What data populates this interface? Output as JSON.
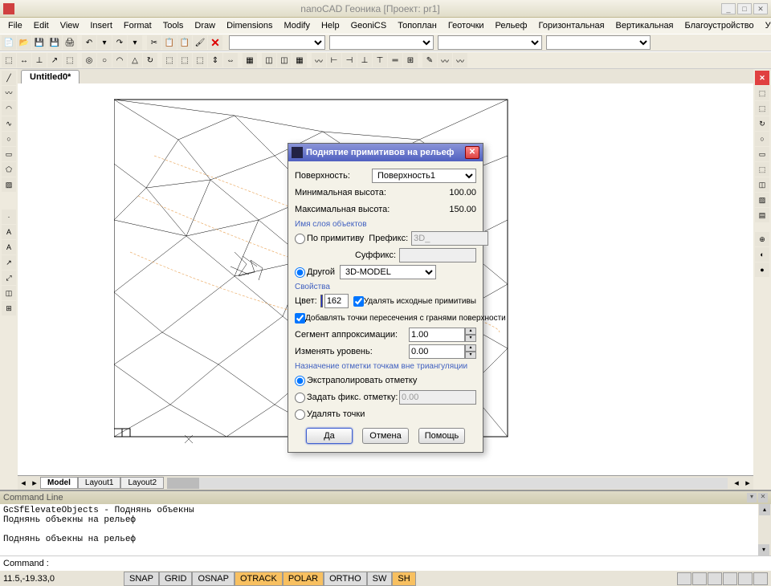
{
  "app": {
    "title": "nanoCAD Геоника [Проект: pr1]"
  },
  "menu": [
    "File",
    "Edit",
    "View",
    "Insert",
    "Format",
    "Tools",
    "Draw",
    "Dimensions",
    "Modify",
    "Help",
    "GeoniCS",
    "Топоплан",
    "Геоточки",
    "Рельеф",
    "Горизонтальная",
    "Вертикальная",
    "Благоустройство",
    "Утилиты"
  ],
  "doc_tab": "Untitled0*",
  "layout_tabs": {
    "active": "Model",
    "tabs": [
      "Model",
      "Layout1",
      "Layout2"
    ]
  },
  "cmd": {
    "title": "Command Line",
    "text": "GcSfElevateObjects - Поднянь объекны\nПоднянь объекны на рельеф\n\nПоднянь объекны на рельеф",
    "prompt": "Command :"
  },
  "status": {
    "coords": "11.5,-19.33,0",
    "toggles": [
      {
        "label": "SNAP",
        "on": false
      },
      {
        "label": "GRID",
        "on": false
      },
      {
        "label": "OSNAP",
        "on": false
      },
      {
        "label": "OTRACK",
        "on": true
      },
      {
        "label": "POLAR",
        "on": true
      },
      {
        "label": "ORTHO",
        "on": false
      },
      {
        "label": "SW",
        "on": false
      },
      {
        "label": "SH",
        "on": true
      }
    ]
  },
  "dialog": {
    "title": "Поднятие примитивов на рельеф",
    "surface_label": "Поверхность:",
    "surface_value": "Поверхность1",
    "min_h_label": "Минимальная высота:",
    "min_h_value": "100.00",
    "max_h_label": "Максимальная высота:",
    "max_h_value": "150.00",
    "layer_section": "Имя слоя объектов",
    "by_prim": "По примитиву",
    "prefix": "Префикс:",
    "prefix_val": "3D_",
    "suffix": "Суффикс:",
    "other": "Другой",
    "other_layer": "3D-MODEL",
    "props_section": "Свойства",
    "color_label": "Цвет:",
    "color_num": "162",
    "delete_src": "Удалять исходные примитивы",
    "add_points": "Добавлять точки пересечения с гранями поверхности",
    "segment_label": "Сегмент аппроксимации:",
    "segment_val": "1.00",
    "change_level_label": "Изменять уровень:",
    "change_level_val": "0.00",
    "elev_section": "Назначение отметки точкам вне триангуляции",
    "extrapolate": "Экстраполировать отметку",
    "fix_mark": "Задать фикс. отметку:",
    "fix_val": "0.00",
    "delete_pts": "Удалять точки",
    "ok": "Да",
    "cancel": "Отмена",
    "help": "Помощь"
  }
}
